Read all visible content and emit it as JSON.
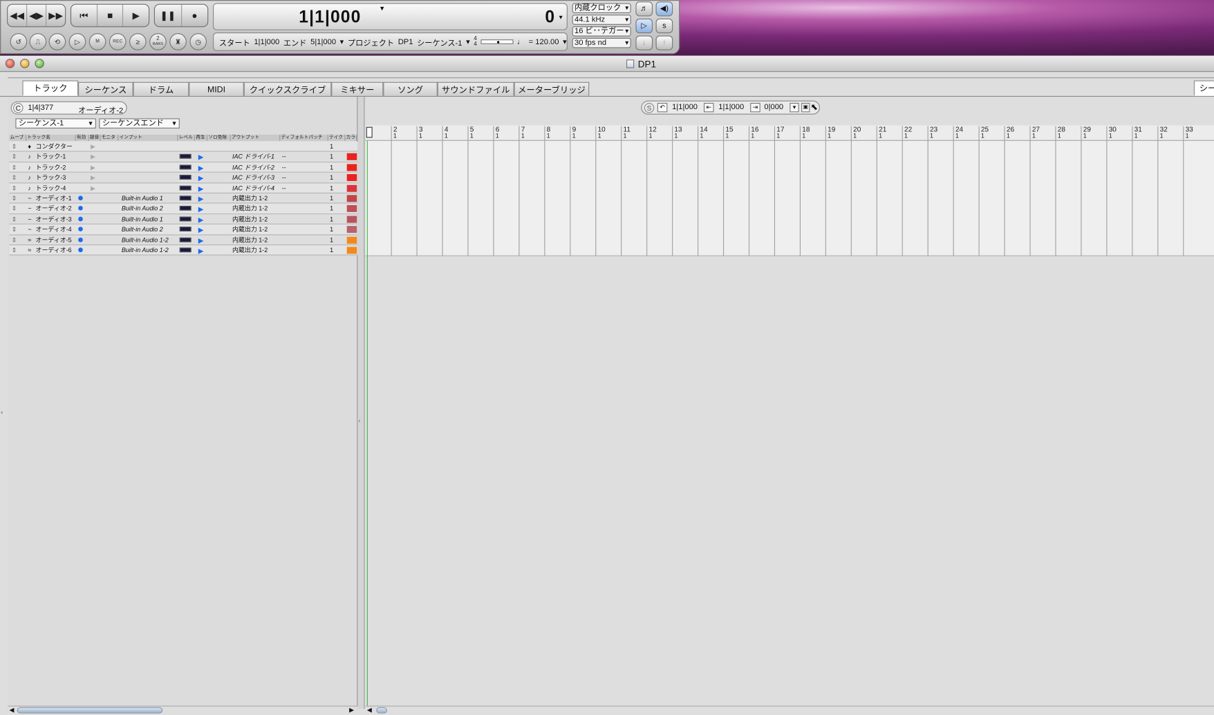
{
  "transport": {
    "counter_main": "1|1|000",
    "counter_right": "0",
    "info": {
      "start_label": "スタート",
      "start_value": "1|1|000",
      "end_label": "エンド",
      "end_value": "5|1|000",
      "project_label": "プロジェクト",
      "project_value": "DP1",
      "sequence": "シーケンス-1",
      "meter_top": "4",
      "meter_bottom": "4",
      "tempo": "= 120.00"
    },
    "selects": [
      "内蔵クロック",
      "44.1 kHz",
      "16 ビ･･テガー",
      "30 fps nd"
    ],
    "tool_labels": {
      "rec": "REC",
      "bars_num": "2",
      "bars": "BARS"
    }
  },
  "window": {
    "title": "DP1"
  },
  "tabs": [
    "トラック",
    "シーケンス",
    "ドラム",
    "MIDI",
    "クイックスクライブ",
    "ミキサー",
    "ソング",
    "サウンドファイル",
    "メーターブリッジ"
  ],
  "right_tab_fragment": "シー",
  "left_header": {
    "position": "1|4|377",
    "track": "オーディオ-2",
    "sequence_select": "シーケンス-1",
    "end_select": "シーケンスエンド",
    "c_label": "C"
  },
  "right_header": {
    "s_label": "S",
    "pos1": "1|1|000",
    "pos2": "1|1|000",
    "pos3": "0|000"
  },
  "columns": [
    "ムーブ",
    "トラック名",
    "有効",
    "録音",
    "モニタ",
    "インプット",
    "レベル",
    "再生",
    "ソロ免除",
    "アウトプット",
    "ディフォルトパッチ",
    "テイク",
    "カラー"
  ],
  "tracks": [
    {
      "icon": "♦",
      "name": "コンダクター",
      "input": "",
      "output": "",
      "patch": "",
      "take": "1",
      "color": ""
    },
    {
      "icon": "♪",
      "name": "トラック-1",
      "input": "",
      "output": "IAC ドライバ-1",
      "patch": "--",
      "take": "1",
      "color": "#e8231f"
    },
    {
      "icon": "♪",
      "name": "トラック-2",
      "input": "",
      "output": "IAC ドライバ-2",
      "patch": "--",
      "take": "1",
      "color": "#e8231f"
    },
    {
      "icon": "♪",
      "name": "トラック-3",
      "input": "",
      "output": "IAC ドライバ-3",
      "patch": "--",
      "take": "1",
      "color": "#e8231f"
    },
    {
      "icon": "♪",
      "name": "トラック-4",
      "input": "",
      "output": "IAC ドライバ-4",
      "patch": "--",
      "take": "1",
      "color": "#d9343a"
    },
    {
      "icon": "~",
      "name": "オーディオ-1",
      "input": "Built-in Audio 1",
      "output": "内蔵出力 1-2",
      "patch": "",
      "take": "1",
      "color": "#c0454a"
    },
    {
      "icon": "~",
      "name": "オーディオ-2",
      "input": "Built-in Audio 2",
      "output": "内蔵出力 1-2",
      "patch": "",
      "take": "1",
      "color": "#bf4f59"
    },
    {
      "icon": "~",
      "name": "オーディオ-3",
      "input": "Built-in Audio 1",
      "output": "内蔵出力 1-2",
      "patch": "",
      "take": "1",
      "color": "#b9535f"
    },
    {
      "icon": "~",
      "name": "オーディオ-4",
      "input": "Built-in Audio 2",
      "output": "内蔵出力 1-2",
      "patch": "",
      "take": "1",
      "color": "#b86369"
    },
    {
      "icon": "≈",
      "name": "オーディオ-5",
      "input": "Built-in Audio 1-2",
      "output": "内蔵出力 1-2",
      "patch": "",
      "take": "1",
      "color": "#f08a1e"
    },
    {
      "icon": "≈",
      "name": "オーディオ-6",
      "input": "Built-in Audio 1-2",
      "output": "内蔵出力 1-2",
      "patch": "",
      "take": "1",
      "color": "#f08a1e"
    }
  ],
  "ruler": {
    "bars": [
      "2",
      "3",
      "4",
      "5",
      "6",
      "7",
      "8",
      "9",
      "10",
      "11",
      "12",
      "13",
      "14",
      "15",
      "16",
      "17",
      "18",
      "19",
      "20",
      "21",
      "22",
      "23",
      "24",
      "25",
      "26",
      "27",
      "28",
      "29",
      "30",
      "31",
      "32",
      "33"
    ],
    "sub": "1"
  }
}
